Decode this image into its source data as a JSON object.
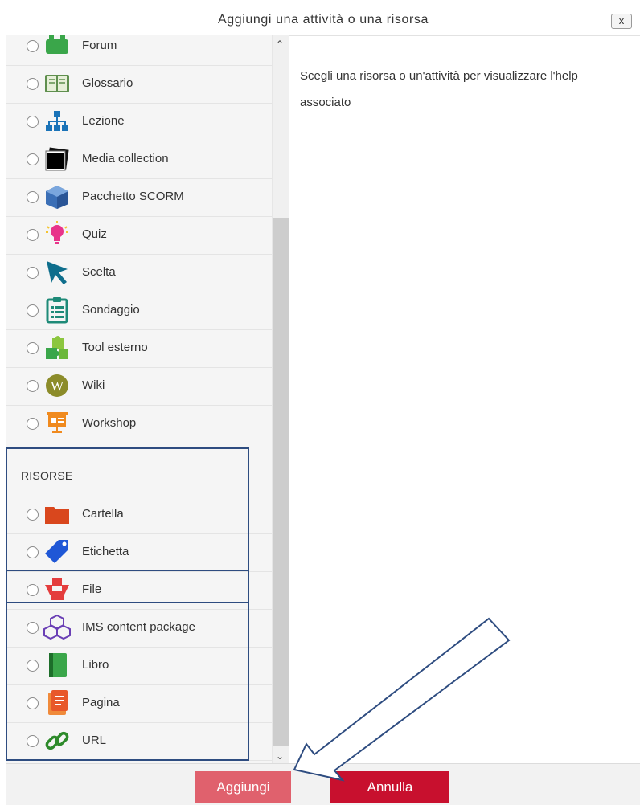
{
  "dialog": {
    "title": "Aggiungi una attività o una risorsa",
    "close_label": "x",
    "help_text": "Scegli una risorsa o un'attività per visualizzare l'help associato"
  },
  "activities": [
    {
      "label": "Forum",
      "icon": "forum-icon"
    },
    {
      "label": "Glossario",
      "icon": "glossary-icon"
    },
    {
      "label": "Lezione",
      "icon": "lesson-icon"
    },
    {
      "label": "Media collection",
      "icon": "media-collection-icon"
    },
    {
      "label": "Pacchetto SCORM",
      "icon": "scorm-icon"
    },
    {
      "label": "Quiz",
      "icon": "quiz-icon"
    },
    {
      "label": "Scelta",
      "icon": "choice-icon"
    },
    {
      "label": "Sondaggio",
      "icon": "survey-icon"
    },
    {
      "label": "Tool esterno",
      "icon": "external-tool-icon"
    },
    {
      "label": "Wiki",
      "icon": "wiki-icon"
    },
    {
      "label": "Workshop",
      "icon": "workshop-icon"
    }
  ],
  "resources_section": "RISORSE",
  "resources": [
    {
      "label": "Cartella",
      "icon": "folder-icon"
    },
    {
      "label": "Etichetta",
      "icon": "label-tag-icon"
    },
    {
      "label": "File",
      "icon": "file-icon"
    },
    {
      "label": "IMS content package",
      "icon": "ims-package-icon"
    },
    {
      "label": "Libro",
      "icon": "book-icon"
    },
    {
      "label": "Pagina",
      "icon": "page-icon"
    },
    {
      "label": "URL",
      "icon": "url-link-icon"
    }
  ],
  "buttons": {
    "add": "Aggiungi",
    "cancel": "Annulla"
  },
  "colors": {
    "add_button": "#e0616d",
    "cancel_button": "#c8102e",
    "highlight_border": "#2e4c80"
  }
}
